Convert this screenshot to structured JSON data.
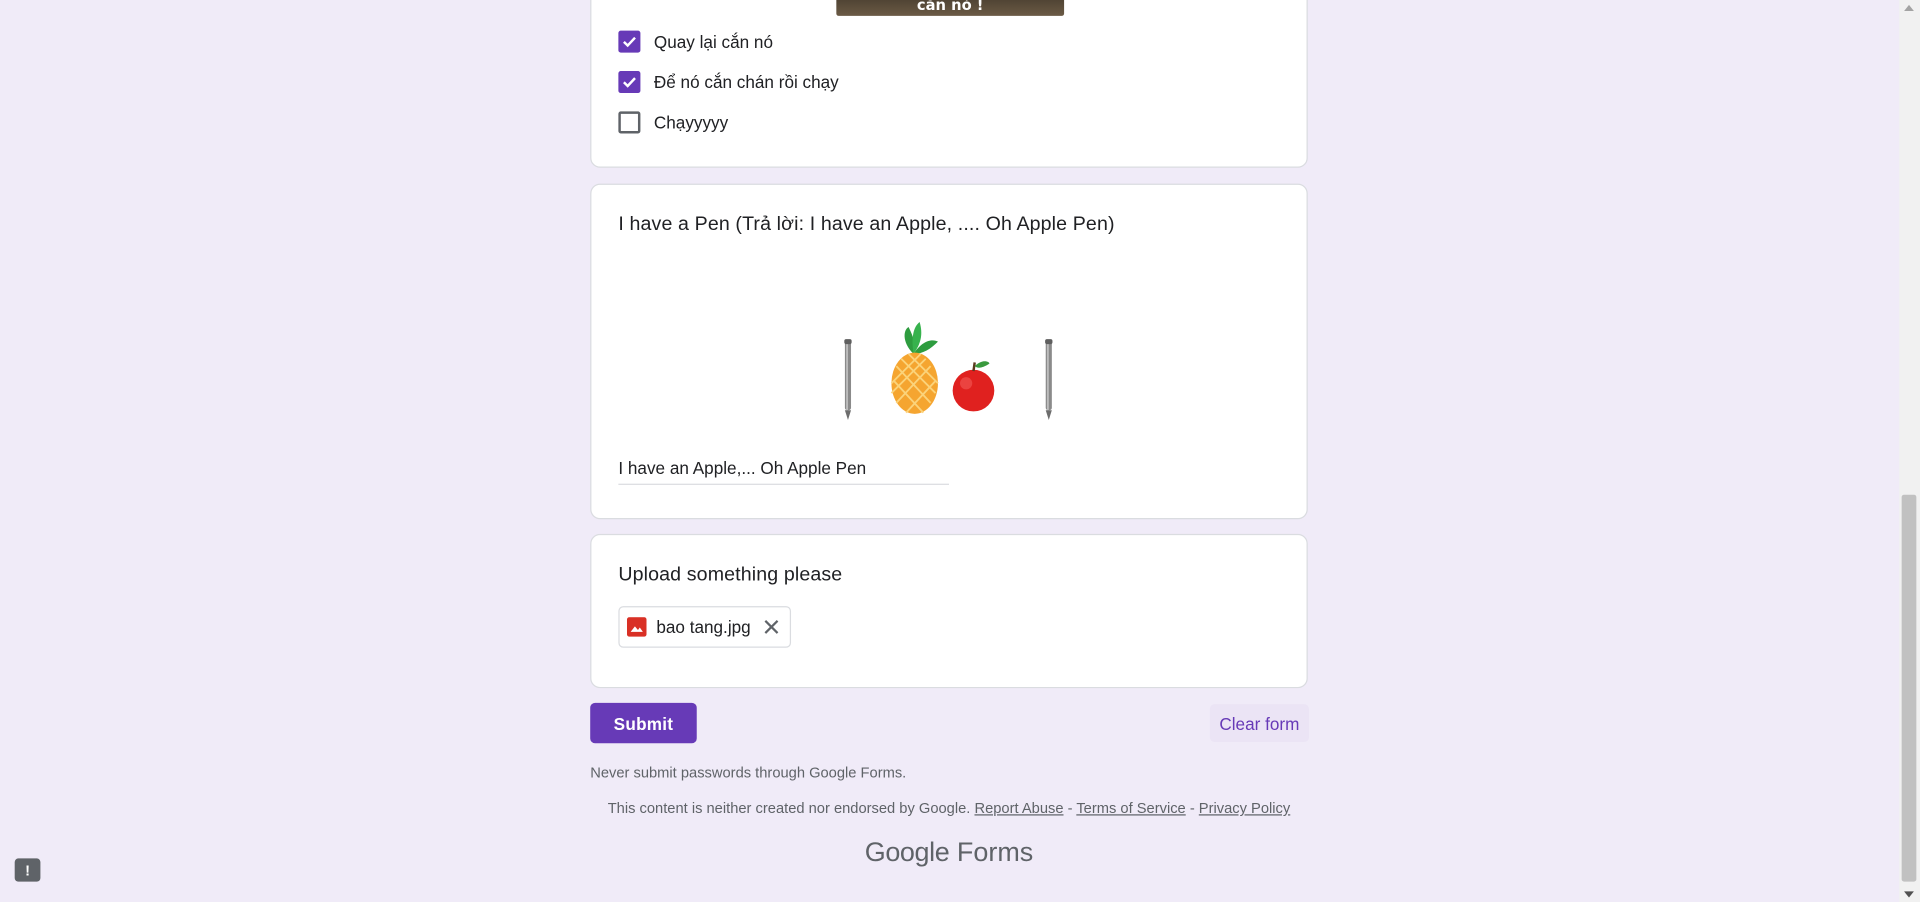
{
  "checkbox_question": {
    "image_caption": "cắn nó !",
    "options": [
      {
        "label": "Quay lại cắn nó",
        "checked": true
      },
      {
        "label": "Để nó cắn chán rồi chạy",
        "checked": true
      },
      {
        "label": "Chạyyyyy",
        "checked": false
      }
    ]
  },
  "pen_question": {
    "title": "I have a Pen (Trả lời: I have an Apple, .... Oh Apple Pen)",
    "image_icons": [
      "pen-icon",
      "pineapple-icon",
      "apple-icon",
      "pen-icon"
    ],
    "answer": "I have an Apple,... Oh Apple Pen"
  },
  "upload_question": {
    "title": "Upload something please",
    "file_name": "bao tang.jpg",
    "file_icon": "image-file-icon"
  },
  "actions": {
    "submit_label": "Submit",
    "clear_label": "Clear form"
  },
  "footer": {
    "notice": "Never submit passwords through Google Forms.",
    "disclaimer": "This content is neither created nor endorsed by Google.",
    "report_abuse": "Report Abuse",
    "separator": " - ",
    "terms": "Terms of Service",
    "privacy": "Privacy Policy",
    "brand_google": "Google",
    "brand_forms": "Forms"
  },
  "colors": {
    "accent": "#673ab7",
    "background": "#f0ebf8",
    "clear_bg": "#ebe4f5"
  }
}
